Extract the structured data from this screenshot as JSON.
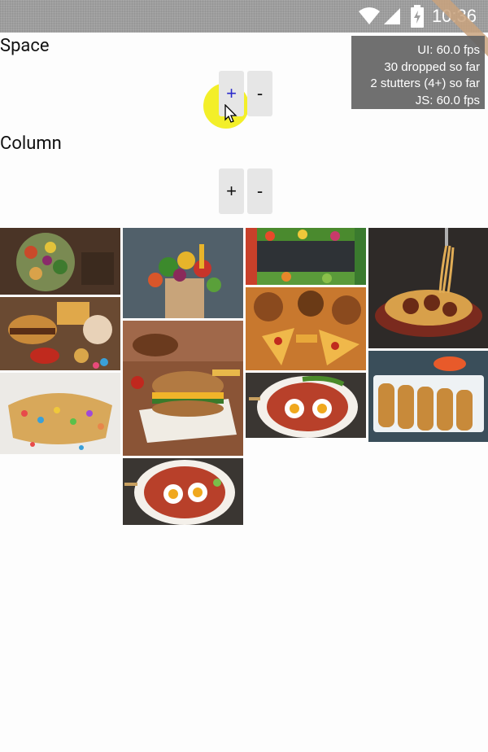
{
  "status_bar": {
    "time": "10:36",
    "icons": [
      "wifi-icon",
      "cell-signal-icon",
      "battery-charging-icon"
    ]
  },
  "perf_monitor": {
    "lines": [
      "UI: 60.0 fps",
      "30 dropped so far",
      "2 stutters (4+) so far",
      "JS: 60.0 fps"
    ]
  },
  "space_section": {
    "label": "Space",
    "plus_label": "+",
    "minus_label": "-"
  },
  "column_section": {
    "label": "Column",
    "plus_label": "+",
    "minus_label": "-"
  },
  "gallery": {
    "images": [
      "vegetables bowl",
      "fast food platter",
      "waffle with candies",
      "vegetables paper bag",
      "burger on wrapper",
      "shakshuka eggs",
      "vegetable frame",
      "burgers and pizza",
      "shakshuka eggs",
      "spaghetti meatballs",
      "spring rolls"
    ]
  },
  "colors": {
    "touch_indicator": "#f2ee1e",
    "active_plus": "#2a2acc",
    "button_bg": "#e6e6e6"
  }
}
